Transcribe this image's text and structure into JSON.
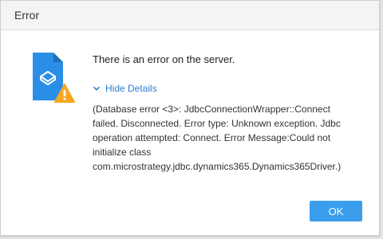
{
  "dialog": {
    "title": "Error",
    "message": "There is an error on the server.",
    "toggle_label": "Hide Details",
    "details_lines": [
      "(Database error <3>: JdbcConnectionWrapper::Connect",
      "failed. Disconnected. Error type: Unknown exception. Jdbc",
      "operation attempted: Connect. Error Message:Could not",
      "initialize class",
      "com.microstrategy.jdbc.dynamics365.Dynamics365Driver.)"
    ],
    "ok_label": "OK"
  },
  "icons": {
    "document": "document-icon",
    "warning": "warning-icon",
    "toggle": "chevron-down-icon"
  },
  "colors": {
    "accent": "#3b9eed",
    "link": "#2a7fd4",
    "document": "#2b8ee6",
    "warning": "#f5a623"
  }
}
